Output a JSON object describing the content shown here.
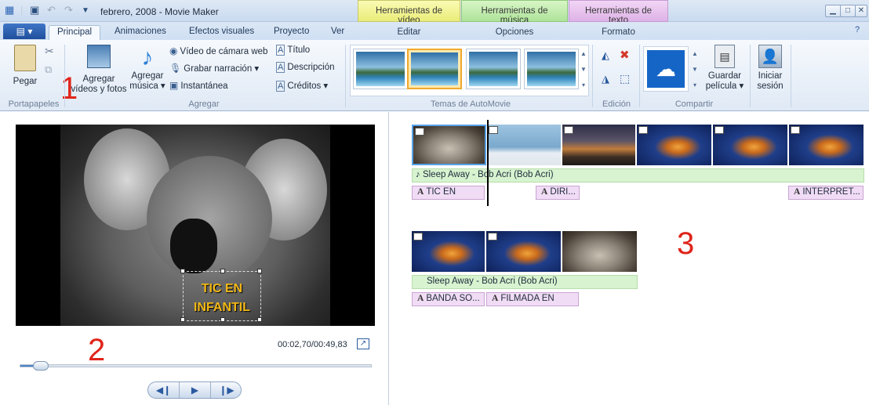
{
  "window": {
    "title": "febrero, 2008 - Movie Maker"
  },
  "context_tabs": {
    "video": "Herramientas de vídeo",
    "music": "Herramientas de música",
    "text": "Herramientas de texto"
  },
  "tabs": {
    "file": "▤ ▾",
    "items": [
      "Principal",
      "Animaciones",
      "Efectos visuales",
      "Proyecto",
      "Ver"
    ],
    "ctx_edit": "Editar",
    "ctx_options": "Opciones",
    "ctx_format": "Formato"
  },
  "ribbon": {
    "clipboard": {
      "paste": "Pegar",
      "group": "Portapapeles"
    },
    "add": {
      "add_videos_l1": "Agregar",
      "add_videos_l2": "vídeos y fotos",
      "add_music_l1": "Agregar",
      "add_music_l2": "música ▾",
      "webcam": "Vídeo de cámara web",
      "narration": "Grabar narración ▾",
      "snapshot": "Instantánea",
      "title": "Título",
      "caption": "Descripción",
      "credits": "Créditos ▾",
      "group": "Agregar"
    },
    "themes": {
      "group": "Temas de AutoMovie"
    },
    "edit": {
      "group": "Edición"
    },
    "share": {
      "save_l1": "Guardar",
      "save_l2": "película ▾",
      "group": "Compartir"
    },
    "signin": {
      "l1": "Iniciar",
      "l2": "sesión"
    }
  },
  "annotations": {
    "one": "1",
    "two": "2",
    "three": "3"
  },
  "preview": {
    "overlay_l1": "TIC EN",
    "overlay_l2": "INFANTIL",
    "timecode": "00:02,70/00:49,83",
    "progress_fraction": 0.054
  },
  "storyboard": {
    "row1": {
      "audio": "Sleep Away - Bob Acri (Bob Acri)",
      "captions": [
        "TIC EN",
        "DIRI...",
        "INTERPRET..."
      ]
    },
    "row2": {
      "audio": "Sleep Away - Bob Acri (Bob Acri)",
      "captions": [
        "BANDA SO...",
        "FILMADA EN"
      ]
    }
  },
  "colors": {
    "accent": "#1f4f9c",
    "annotation": "#e0241b",
    "overlay_text": "#f3b816"
  }
}
